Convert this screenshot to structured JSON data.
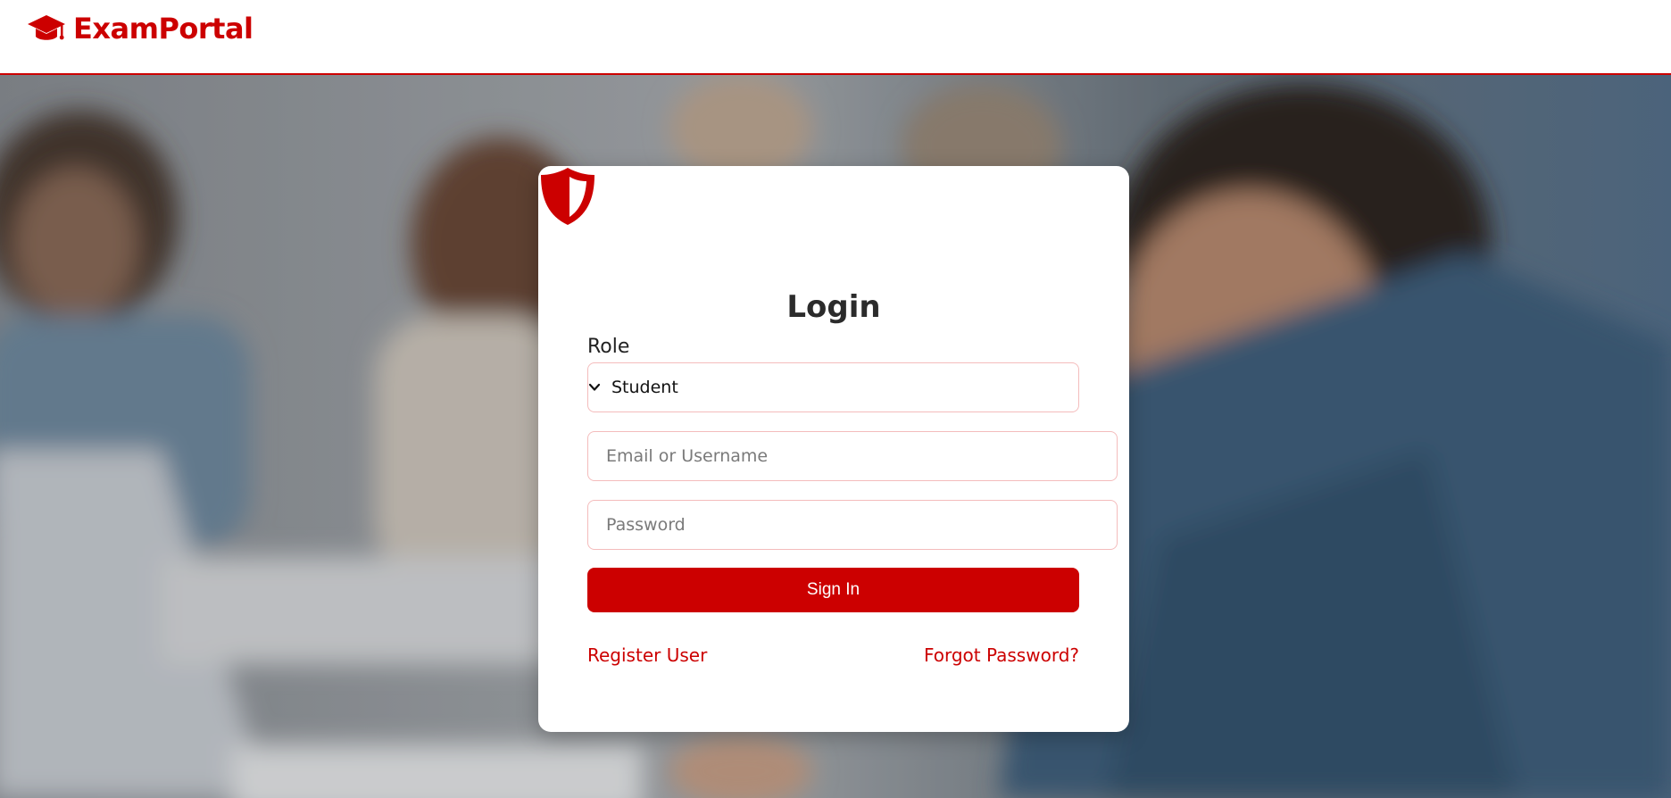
{
  "app": {
    "brand": "ExamPortal"
  },
  "colors": {
    "accent": "#cc0000",
    "border": "#f4bcbc"
  },
  "icons": {
    "brand": "graduation-cap-icon",
    "login": "shield-icon",
    "select": "chevron-down-icon"
  },
  "login": {
    "title": "Login",
    "role_label": "Role",
    "role_selected": "Student",
    "email_placeholder": "Email or Username",
    "password_placeholder": "Password",
    "signin_label": "Sign In",
    "register_label": "Register User",
    "forgot_label": "Forgot Password?"
  }
}
